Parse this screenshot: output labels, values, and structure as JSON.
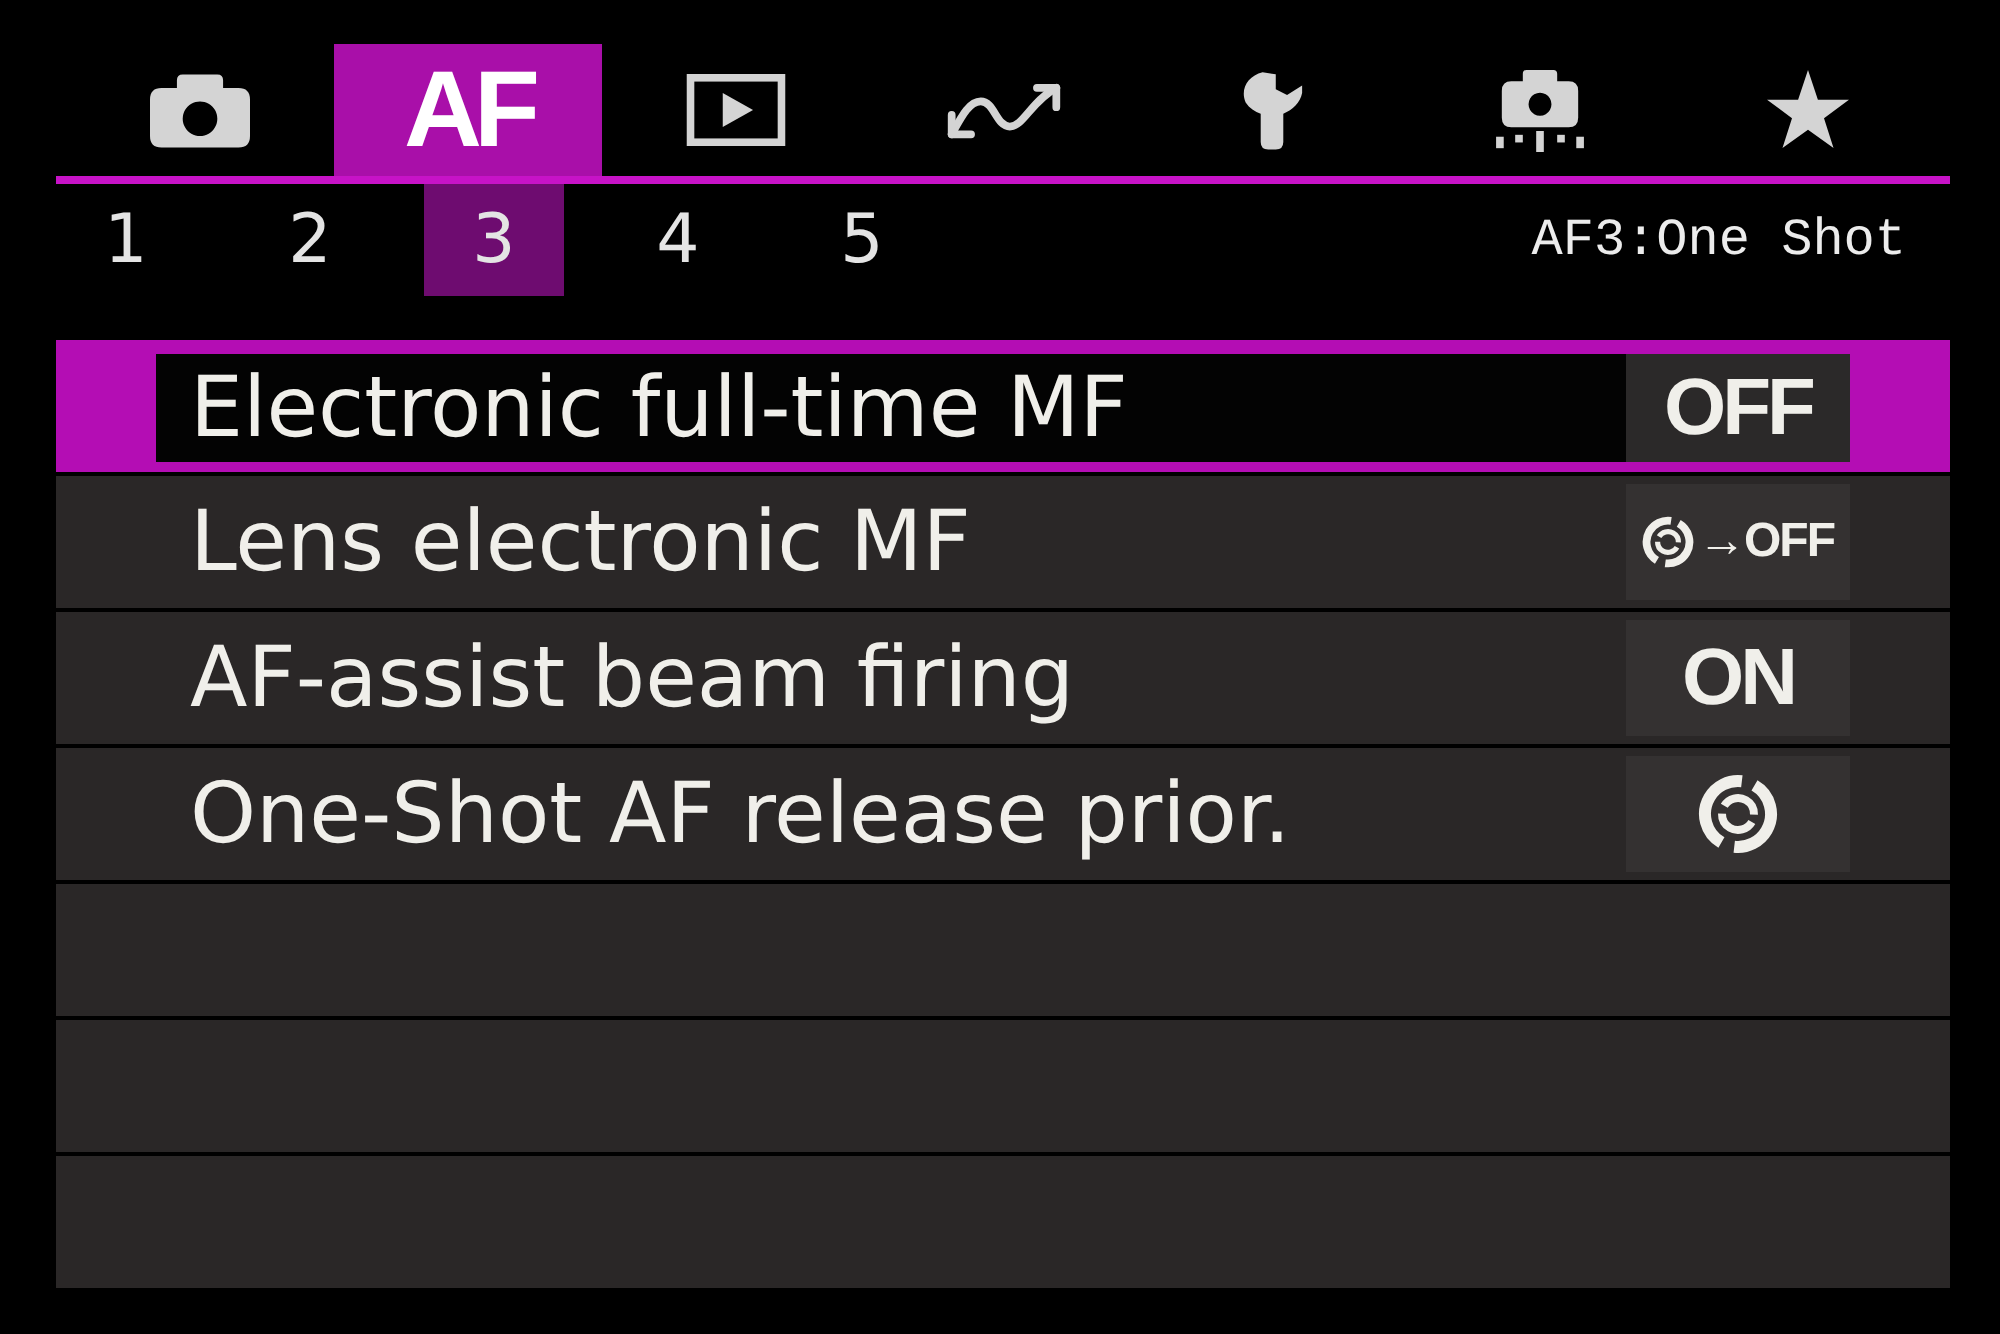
{
  "tabs": [
    {
      "kind": "camera",
      "selected": false
    },
    {
      "kind": "text",
      "label": "AF",
      "selected": true
    },
    {
      "kind": "play",
      "selected": false
    },
    {
      "kind": "wave",
      "selected": false
    },
    {
      "kind": "wrench",
      "selected": false
    },
    {
      "kind": "cameradots",
      "selected": false
    },
    {
      "kind": "star",
      "selected": false
    }
  ],
  "pages": [
    {
      "label": "1",
      "selected": false
    },
    {
      "label": "2",
      "selected": false
    },
    {
      "label": "3",
      "selected": true
    },
    {
      "label": "4",
      "selected": false
    },
    {
      "label": "5",
      "selected": false
    }
  ],
  "page_title": "AF3:One Shot",
  "menu": {
    "items": [
      {
        "label": "Electronic full-time MF",
        "selected": true,
        "kind": "text",
        "value": "OFF"
      },
      {
        "label": "Lens electronic MF",
        "selected": false,
        "kind": "icontext",
        "value": "→OFF"
      },
      {
        "label": "AF-assist beam firing",
        "selected": false,
        "kind": "text",
        "value": "ON"
      },
      {
        "label": "One-Shot AF release prior.",
        "selected": false,
        "kind": "icon"
      }
    ]
  }
}
